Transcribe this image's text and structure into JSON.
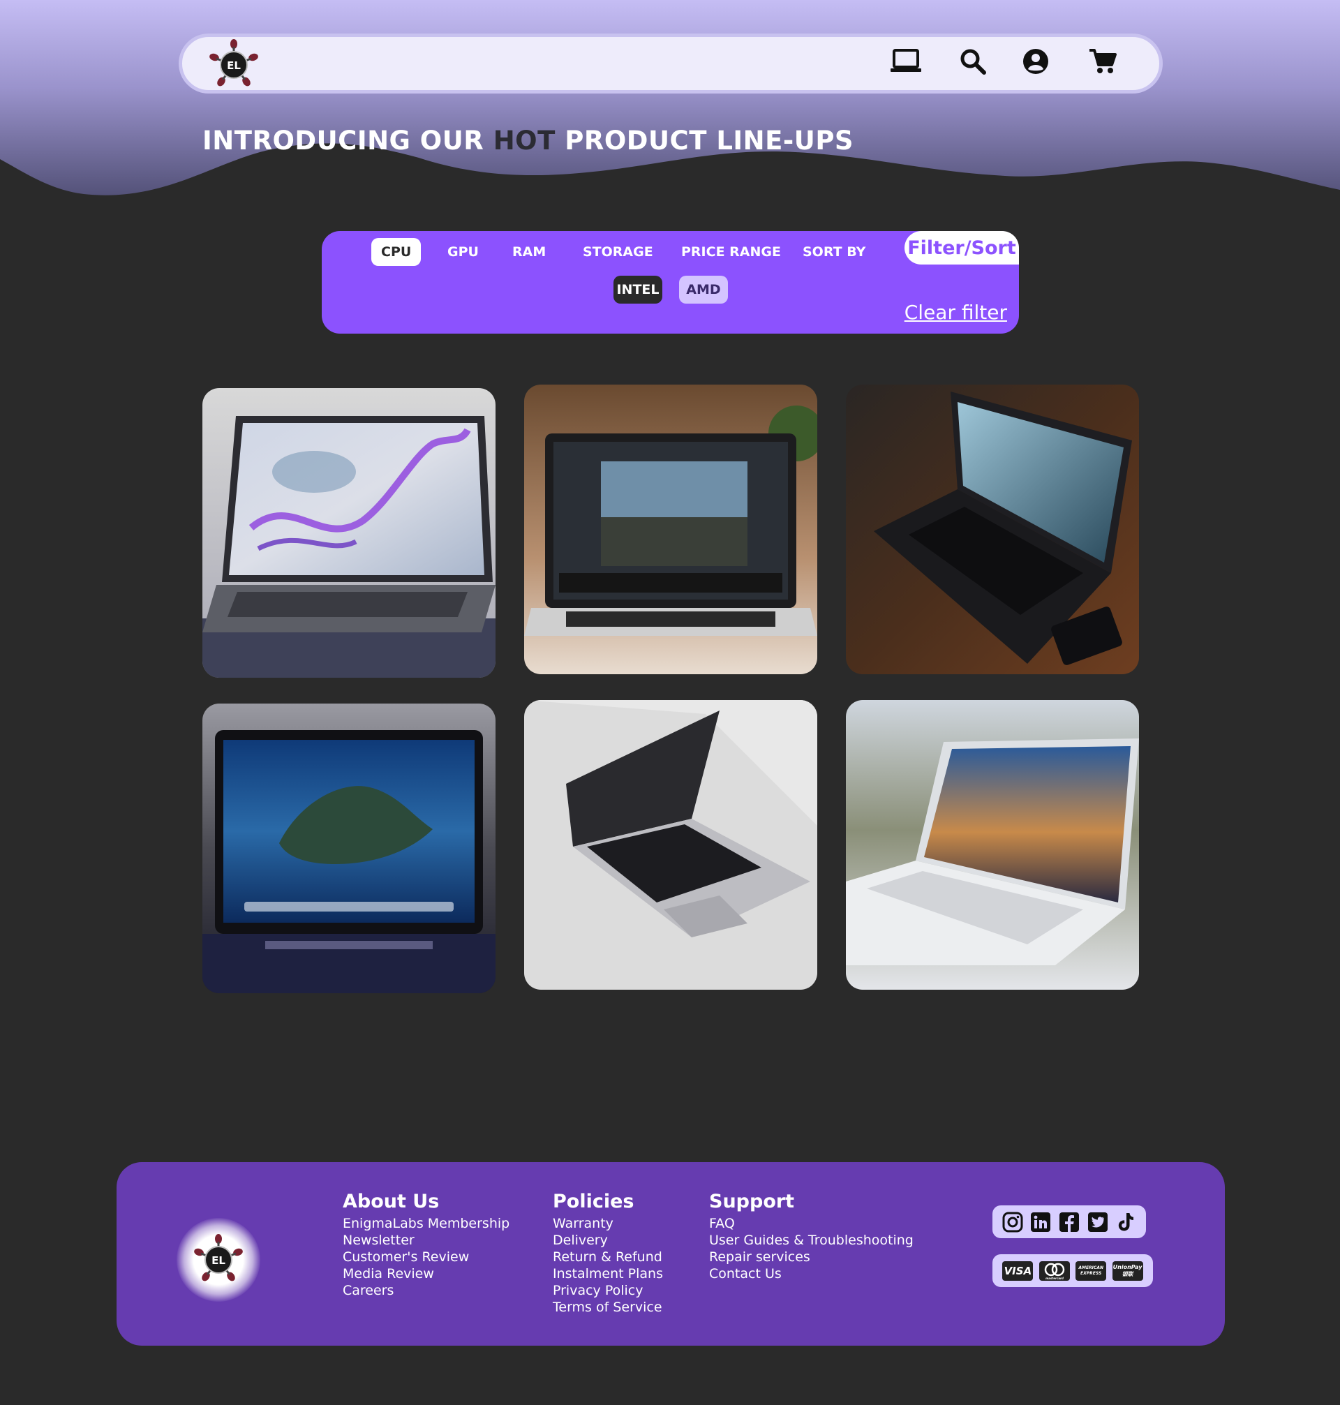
{
  "brand": {
    "logo_text": "EL"
  },
  "colors": {
    "accent": "#8c52fe",
    "footer": "#663cb0",
    "background": "#2a2a2a",
    "hero_top": "#c5bdf4",
    "hero_wave": "#5c5a86",
    "navbar_bg": "#eeecfb"
  },
  "nav": {
    "icons": [
      "laptop-icon",
      "search-icon",
      "account-icon",
      "cart-icon"
    ]
  },
  "hero": {
    "title_before": "INTRODUCING OUR ",
    "title_highlight": "HOT",
    "title_after": " PRODUCT LINE-UPS"
  },
  "filter": {
    "tabs": [
      "CPU",
      "GPU",
      "RAM",
      "STORAGE",
      "PRICE RANGE",
      "SORT BY"
    ],
    "active_tab": "CPU",
    "label": "Filter/Sort",
    "options": [
      "INTEL",
      "AMD"
    ],
    "selected_option": "INTEL",
    "clear_label": "Clear filter"
  },
  "products": [
    {
      "image": "laptop with purple marble wallpaper"
    },
    {
      "image": "laptop with photo editing software"
    },
    {
      "image": "dark laptop on wooden desk"
    },
    {
      "image": "laptop with island wallpaper"
    },
    {
      "image": "silver laptop on white surface"
    },
    {
      "image": "white laptop with city wallpaper"
    }
  ],
  "footer": {
    "about": {
      "heading": "About Us",
      "links": [
        "EnigmaLabs Membership",
        "Newsletter",
        "Customer's Review",
        "Media Review",
        "Careers"
      ]
    },
    "policies": {
      "heading": "Policies",
      "links": [
        "Warranty",
        "Delivery",
        "Return & Refund",
        "Instalment Plans",
        "Privacy Policy",
        "Terms of Service"
      ]
    },
    "support": {
      "heading": "Support",
      "links": [
        "FAQ",
        "User Guides & Troubleshooting",
        "Repair services",
        "Contact Us"
      ]
    },
    "social_icons": [
      "instagram-icon",
      "linkedin-icon",
      "facebook-icon",
      "twitter-icon",
      "tiktok-icon"
    ],
    "payments": [
      "VISA",
      "mastercard",
      "AMERICAN EXPRESS",
      "UnionPay 银联"
    ]
  }
}
